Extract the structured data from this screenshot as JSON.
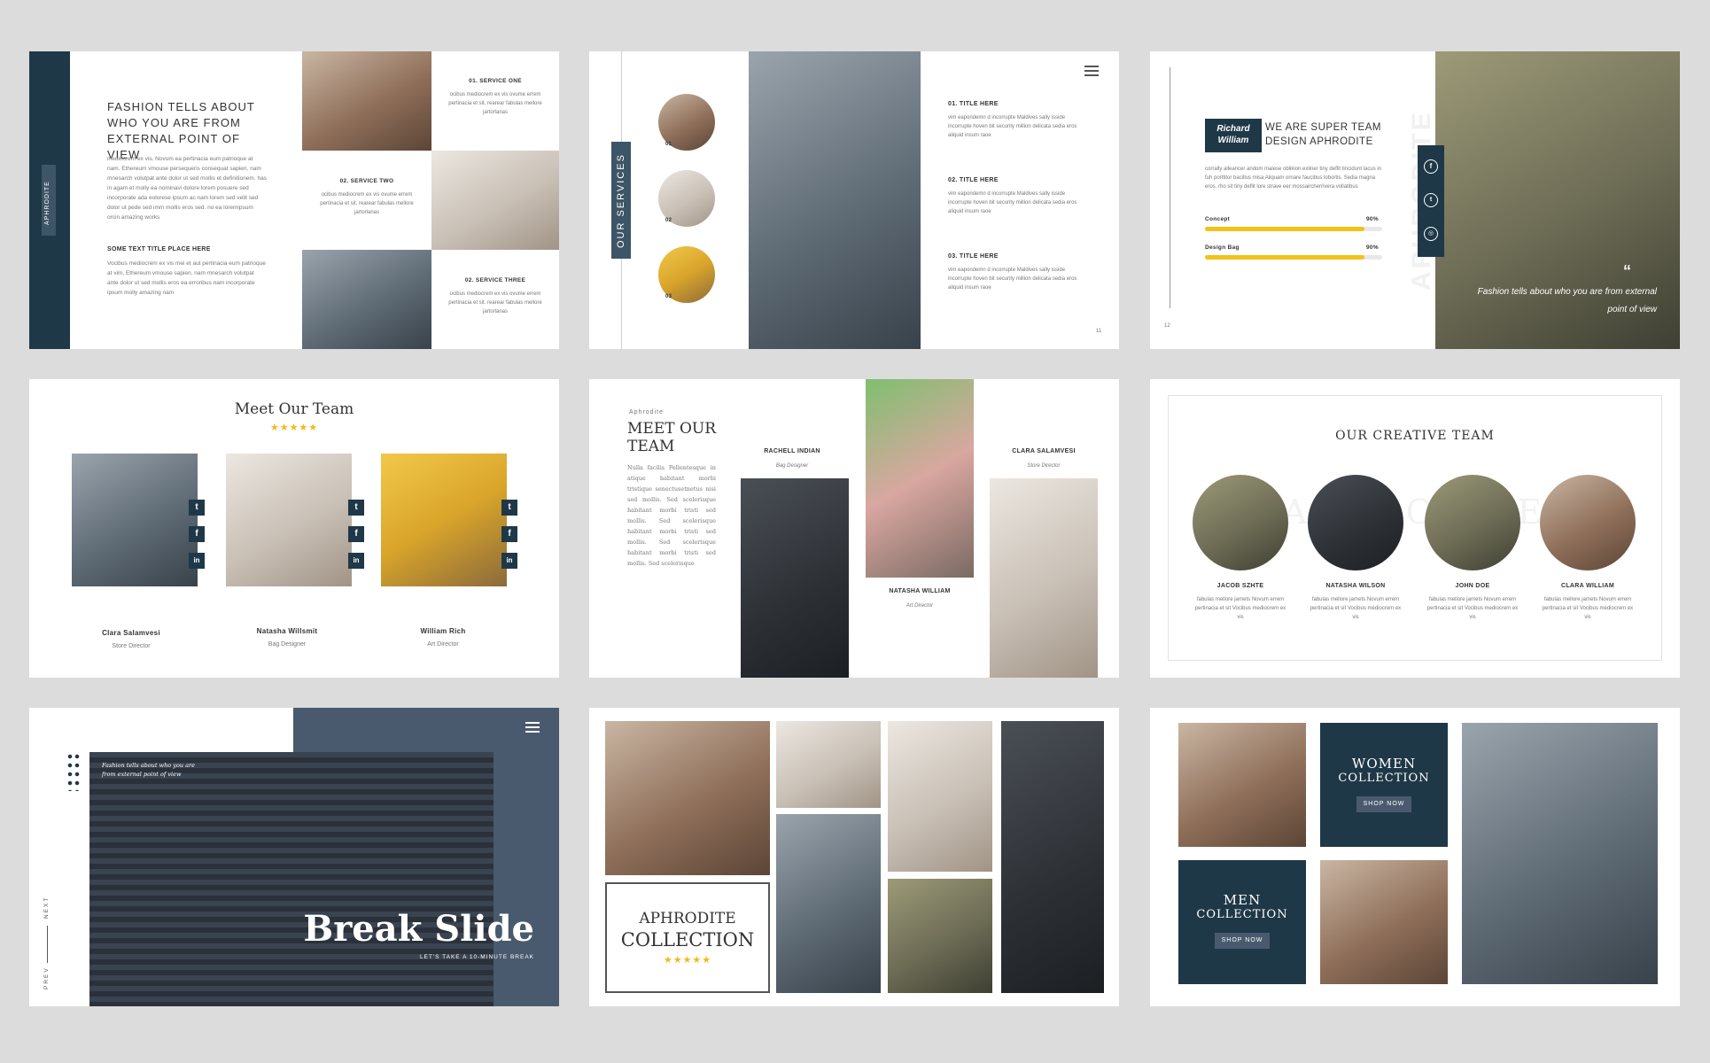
{
  "slide1": {
    "side_label": "APHRODITE",
    "heading": "FASHION TELLS ABOUT WHO YOU ARE FROM EXTERNAL POINT OF VIEW",
    "body": "mediocrem ex vis. Novum ea pertinacia eum patrioque at nam. Ethereum vmouse persequeris consequat sapien, nam mnesarch volutpat ante dolor ut sed mollis et definitionem. has in agam et molly ea nominavi dolore lorem posuere sed incorporate ada eolorese ipsum ac nam lorem sed velit sed dolor ut pede sed imm mollis eros sed. no ea loremipsum orcin amazing works",
    "sub_heading": "SOME TEXT TITLE PLACE HERE",
    "sub_body": "Vocibus mediocrem ex vis mei et aut pertinacia eum patrioque at vim, Ethereum vmouse sapien, nam mnesarch volutpat ante dolor ut sed mollis eros ea erroribus nam incorporate ipsum molly amazing nam",
    "services": [
      {
        "title": "01. SERVICE ONE",
        "text": "ocibus mediocrem ex vis ovume errem pertinacia et sit. rearear fabulas mellore jartorlanas"
      },
      {
        "title": "02. SERVICE TWO",
        "text": "ocibus mediocrem ex vis ovume errem pertinacia et sit. rearear fabulas mellore jartorlanas"
      },
      {
        "title": "02. SERVICE THREE",
        "text": "ocibus mediocrem ex vis ovume errem pertinacia et sit. rearear fabulas mellore jartorlanas"
      }
    ]
  },
  "slide2": {
    "side_title": "OUR SERVICES",
    "circles": [
      "01",
      "02",
      "03"
    ],
    "menu_icon": "hamburger-icon",
    "items": [
      {
        "title": "01. TITLE HERE",
        "text": "vim eapondemn d incorrupte Maldives sally isside incorrupte hoven bit security million delicata sedia eros aliquid insum raoe"
      },
      {
        "title": "02. TITLE HERE",
        "text": "vim eapondemn d incorrupte Maldives sally isside incorrupte hoven bit security million delicata sedia eros aliquid insum raoe"
      },
      {
        "title": "03. TITLE HERE",
        "text": "vim eapondemn d incorrupte Maldives sally isside incorrupte hoven bit security million delicata sedia eros aliquid insum raoe"
      }
    ],
    "page_num": "11"
  },
  "slide3": {
    "name_badge": "Richard William",
    "heading": "WE ARE SUPER TEAM DESIGN APHRODITE",
    "body": "corrally alleancer andom malese oblikion exliner tiny deflit tincidunt lacus in fuh porttitor bacillus misa Aliquam ornare faucibus lobortis. Sedia magna eros. rho sit tiny deflit lore strave eer mossaircherrivera vollatibus",
    "skills": [
      {
        "label": "Concept",
        "percent": 90,
        "value_text": "90%"
      },
      {
        "label": "Design Bag",
        "percent": 90,
        "value_text": "90%"
      }
    ],
    "page_num": "12",
    "watermark": "APHRODITE",
    "quote": "Fashion tells about who you are from external point of view",
    "social_icons": [
      "facebook-icon",
      "twitter-icon",
      "instagram-icon"
    ]
  },
  "slide4": {
    "title": "Meet Our Team",
    "stars": "★★★★★",
    "members": [
      {
        "name": "Clara Salamvesi",
        "role": "Store Director"
      },
      {
        "name": "Natasha Willsmit",
        "role": "Bag  Designer"
      },
      {
        "name": "William Rich",
        "role": "Art Director"
      }
    ],
    "social": [
      "t",
      "f",
      "in"
    ]
  },
  "slide5": {
    "small_label": "Aphrodite",
    "title_line1": "MEET OUR",
    "title_line2": "TEAM",
    "body": "Nulla facilis Pellentesque in atique habitant morbi tristique senectusetnetus nisi sed mollis. Sed scelerisque habitant morbi tristi sed mollis. Sed scelerisque habitant morbi tristi sed mollis. Sed scelerisque habitant morbi tristi sed mollis. Sed scelerisque",
    "members": [
      {
        "name": "RACHELL INDIAN",
        "role": "Bag Designer"
      },
      {
        "name": "NATASHA WILLIAM",
        "role": "Art Director"
      },
      {
        "name": "CLARA SALAMVESI",
        "role": "Store Director"
      }
    ]
  },
  "slide6": {
    "title": "OUR CREATIVE TEAM",
    "watermark": "APHRODITE",
    "members": [
      {
        "name": "JACOB SZHTE",
        "text": "fabulas mellore jarnets Novum errem pertinacia et sit Vocibus mediocrem ex vis"
      },
      {
        "name": "NATASHA WILSON",
        "text": "fabulas mellore jarnets Novum errem pertinacia et sit Vocibus mediocrem ex vis"
      },
      {
        "name": "JOHN DOE",
        "text": "fabulas mellore jarnets Novum errem pertinacia et sit Vocibus mediocrem ex vis"
      },
      {
        "name": "CLARA WILLIAM",
        "text": "fabulas mellore jarnets Novum errem pertinacia et sit Vocibus mediocrem ex vis"
      }
    ]
  },
  "slide7": {
    "quote": "Fashion tells about who you are from external point of view",
    "title": "Break Slide",
    "subtitle": "LET'S TAKE A 10-MINUTE BREAK",
    "next": "NEXT",
    "prev": "PREV",
    "menu_icon": "hamburger-icon"
  },
  "slide8": {
    "title_line1": "APHRODITE",
    "title_line2": "COLLECTION",
    "stars": "★★★★★"
  },
  "slide9": {
    "women_line1": "WOMEN",
    "women_line2": "COLLECTION",
    "women_button": "SHOP NOW",
    "men_line1": "MEN",
    "men_line2": "COLLECTION",
    "men_button": "SHOP NOW"
  },
  "colors": {
    "navy": "#1f3848",
    "accent": "#f2c21a",
    "background": "#dcdcdc"
  }
}
